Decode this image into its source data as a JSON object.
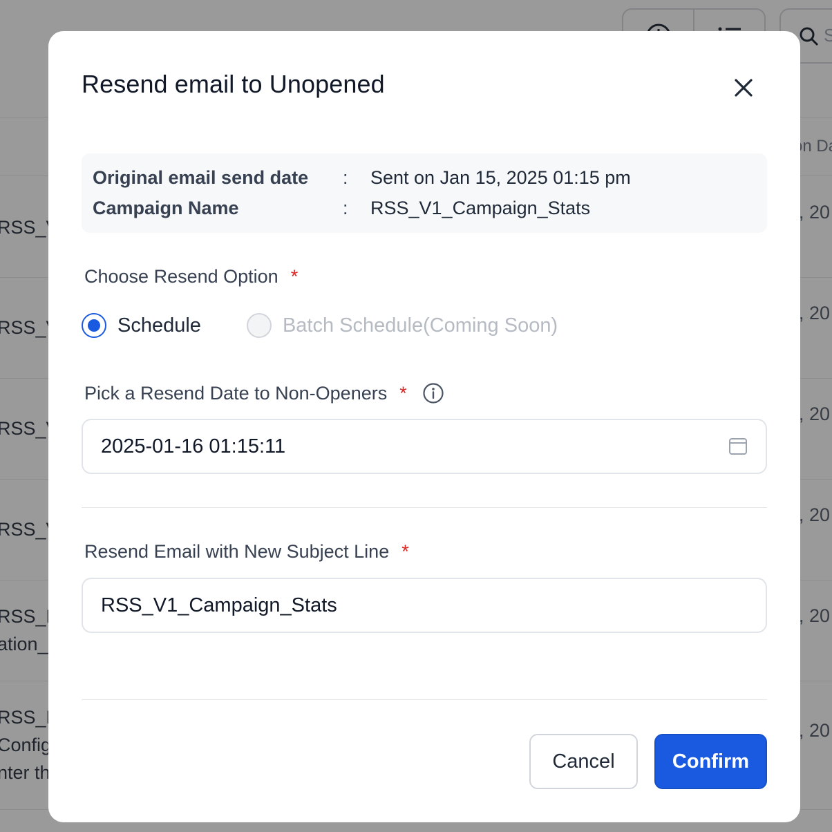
{
  "background": {
    "search_placeholder": "S",
    "column_header": "on Da",
    "rows": [
      {
        "lines": [
          "RSS_V"
        ],
        "date": ", 20"
      },
      {
        "lines": [
          "RSS_V"
        ],
        "date": ", 20"
      },
      {
        "lines": [
          "RSS_V"
        ],
        "date": ", 20"
      },
      {
        "lines": [
          "RSS_V"
        ],
        "date": ", 20"
      },
      {
        "lines": [
          "RSS_P",
          "ation_"
        ],
        "date": ", 20"
      },
      {
        "lines": [
          "RSS_P",
          "Config",
          "nter th"
        ],
        "date": ", 20"
      }
    ]
  },
  "modal": {
    "title": "Resend email to Unopened",
    "close_icon": "close-icon",
    "info": {
      "send_date_label": "Original email send date",
      "send_date_value": "Sent on Jan 15, 2025 01:15 pm",
      "campaign_label": "Campaign Name",
      "campaign_value": "RSS_V1_Campaign_Stats",
      "separator": ":"
    },
    "resend_option": {
      "label": "Choose Resend Option",
      "required_mark": "*",
      "options": [
        {
          "label": "Schedule",
          "selected": true,
          "disabled": false
        },
        {
          "label": "Batch Schedule(Coming Soon)",
          "selected": false,
          "disabled": true
        }
      ]
    },
    "resend_date": {
      "label": "Pick a Resend Date to Non-Openers",
      "required_mark": "*",
      "info_icon": "info-icon",
      "value": "2025-01-16 01:15:11",
      "calendar_icon": "calendar-icon"
    },
    "subject": {
      "label": "Resend Email with New Subject Line",
      "required_mark": "*",
      "value": "RSS_V1_Campaign_Stats"
    },
    "buttons": {
      "cancel": "Cancel",
      "confirm": "Confirm"
    },
    "colors": {
      "primary": "#1a5ae0",
      "required": "#dc2626",
      "overlay": "rgba(30,30,30,0.45)"
    }
  }
}
